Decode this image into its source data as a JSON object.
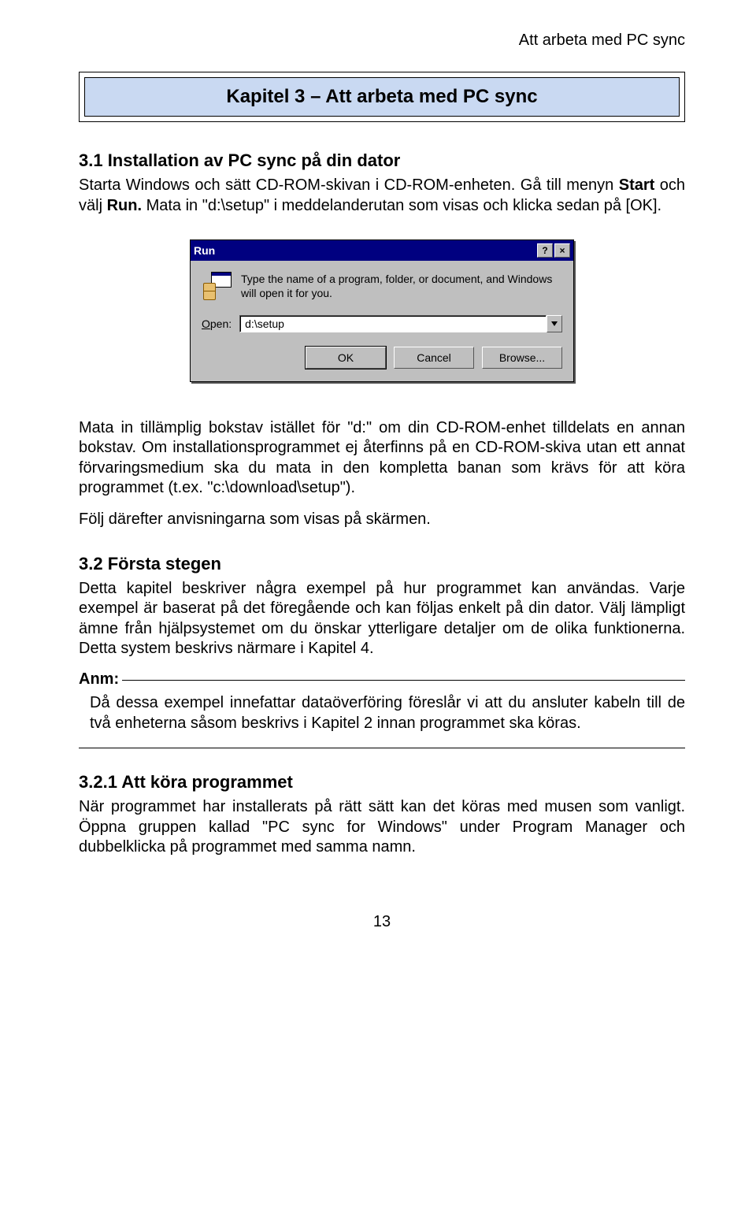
{
  "header": {
    "running_title": "Att arbeta med PC sync"
  },
  "chapter": {
    "title": "Kapitel 3 – Att arbeta med PC sync"
  },
  "s31": {
    "heading": "3.1 Installation av PC sync på din dator",
    "p1a": "Starta Windows och sätt CD-ROM-skivan i CD-ROM-enheten. Gå till menyn ",
    "p1b": "Start",
    "p1c": " och välj ",
    "p1d": "Run.",
    "p1e": " Mata in \"d:\\setup\" i meddelanderutan som visas och klicka sedan på [OK].",
    "p2": "Mata in tillämplig bokstav istället för \"d:\" om din CD-ROM-enhet tilldelats en annan bokstav. Om installationsprogrammet ej återfinns på en CD-ROM-skiva utan ett annat förvaringsmedium ska du mata in den kompletta banan som krävs för att köra programmet (t.ex. \"c:\\download\\setup\").",
    "p3": "Följ därefter anvisningarna som visas på skärmen."
  },
  "dialog": {
    "title": "Run",
    "help_btn": "?",
    "close_btn": "×",
    "description": "Type the name of a program, folder, or document, and Windows will open it for you.",
    "open_label_u": "O",
    "open_label_rest": "pen:",
    "open_value": "d:\\setup",
    "ok": "OK",
    "cancel": "Cancel",
    "browse": "Browse..."
  },
  "s32": {
    "heading": "3.2 Första stegen",
    "p1": "Detta kapitel beskriver några exempel på hur programmet kan användas. Varje exempel är baserat på det föregående och kan följas enkelt på din dator. Välj lämpligt ämne från hjälpsystemet om du önskar ytterligare detaljer om de olika funktionerna. Detta system beskrivs närmare i Kapitel 4.",
    "note_label": "Anm:",
    "note_body": "Då dessa exempel innefattar dataöverföring föreslår vi att du ansluter kabeln till de två enheterna såsom beskrivs i Kapitel 2 innan programmet ska köras."
  },
  "s321": {
    "heading": "3.2.1 Att köra programmet",
    "p1": "När programmet har installerats på rätt sätt kan det köras med musen som vanligt. Öppna gruppen kallad \"PC sync for Windows\" under Program Manager och dubbelklicka på programmet med samma namn."
  },
  "page_number": "13"
}
